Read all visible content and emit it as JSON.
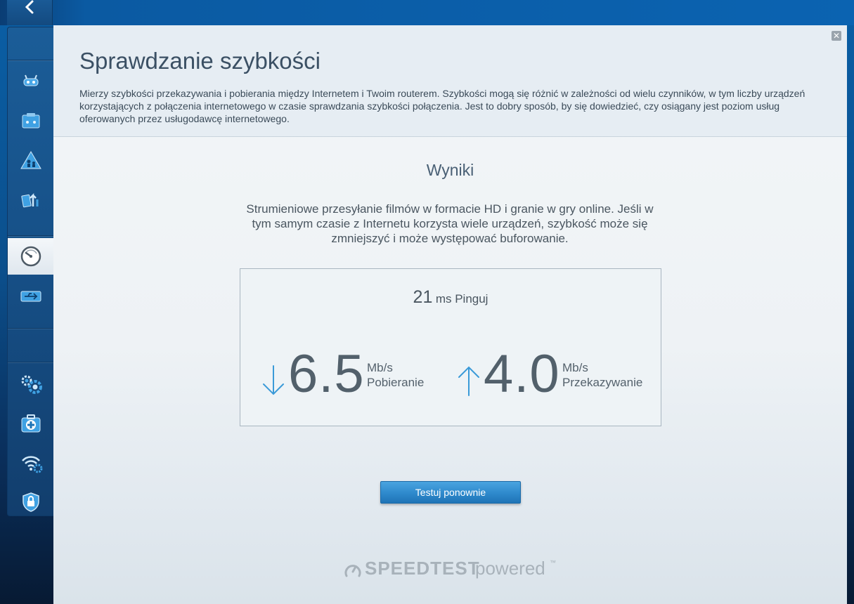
{
  "page": {
    "title": "Sprawdzanie szybkości",
    "description": "Mierzy szybkości przekazywania i pobierania między Internetem i Twoim routerem. Szybkości mogą się różnić w zależności od wielu czynników, w tym liczby urządzeń korzystających z połączenia internetowego w czasie sprawdzania szybkości połączenia. Jest to dobry sposób, by się dowiedzieć, czy osiągany jest poziom usług oferowanych przez usługodawcę internetowego.",
    "close_label": "✕"
  },
  "results": {
    "title": "Wyniki",
    "description": "Strumieniowe przesyłanie filmów w formacie HD i granie w gry online. Jeśli w tym samym czasie z Internetu korzysta wiele urządzeń, szybkość może się zmniejszyć i może występować buforowanie.",
    "ping_value": "21",
    "ping_label": "ms Pinguj",
    "download_value": "6.5",
    "download_unit": "Mb/s",
    "download_label": "Pobieranie",
    "upload_value": "4.0",
    "upload_unit": "Mb/s",
    "upload_label": "Przekazywanie"
  },
  "retest_label": "Testuj ponownie",
  "speedtest_logo": {
    "brand": "SPEEDTEST",
    "suffix": "powered",
    "mark": "™"
  },
  "sidebar": {
    "items": [
      {
        "icon": "network-map-icon"
      },
      {
        "icon": "device-list-icon"
      },
      {
        "icon": "parental-controls-icon"
      },
      {
        "icon": "media-prioritization-icon"
      },
      {
        "icon": "speed-test-icon",
        "active": true
      },
      {
        "icon": "usb-storage-icon"
      },
      {
        "icon": "settings-gears-icon"
      },
      {
        "icon": "troubleshooting-icon"
      },
      {
        "icon": "wireless-settings-icon"
      },
      {
        "icon": "security-shield-icon"
      }
    ]
  },
  "colors": {
    "accent": "#2e89cc",
    "arrow": "#3a9ad8",
    "title": "#3b5064"
  }
}
